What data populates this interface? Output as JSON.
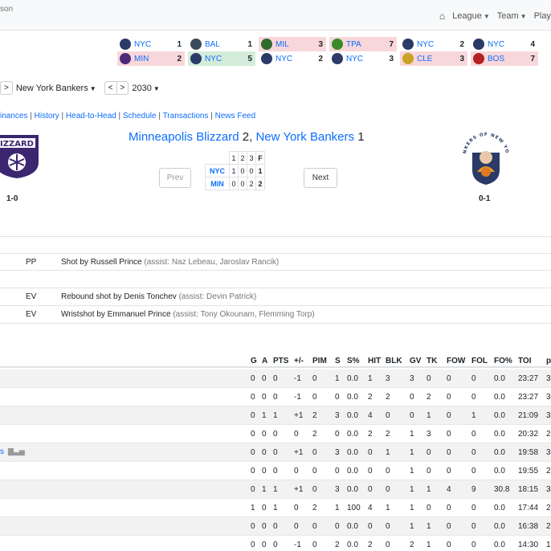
{
  "header": {
    "brand": "son",
    "nav": [
      {
        "label": "League"
      },
      {
        "label": "Team"
      },
      {
        "label": "Play"
      }
    ]
  },
  "scoreboard": [
    {
      "top": {
        "abbr": "NYC",
        "pts": "1",
        "result": "",
        "logo_color": "#2b3a67"
      },
      "bottom": {
        "abbr": "MIN",
        "pts": "2",
        "result": "loss",
        "logo_color": "#4b2a7b"
      }
    },
    {
      "top": {
        "abbr": "BAL",
        "pts": "1",
        "result": "",
        "logo_color": "#3a4a5a"
      },
      "bottom": {
        "abbr": "NYC",
        "pts": "5",
        "result": "win",
        "logo_color": "#2b3a67"
      }
    },
    {
      "top": {
        "abbr": "MIL",
        "pts": "3",
        "result": "loss",
        "logo_color": "#2f6b2f"
      },
      "bottom": {
        "abbr": "NYC",
        "pts": "2",
        "result": "",
        "logo_color": "#2b3a67"
      }
    },
    {
      "top": {
        "abbr": "TPA",
        "pts": "7",
        "result": "loss",
        "logo_color": "#3a8a2a"
      },
      "bottom": {
        "abbr": "NYC",
        "pts": "3",
        "result": "",
        "logo_color": "#2b3a67"
      }
    },
    {
      "top": {
        "abbr": "NYC",
        "pts": "2",
        "result": "",
        "logo_color": "#2b3a67"
      },
      "bottom": {
        "abbr": "CLE",
        "pts": "3",
        "result": "loss",
        "logo_color": "#c9a227"
      }
    },
    {
      "top": {
        "abbr": "NYC",
        "pts": "4",
        "result": "",
        "logo_color": "#2b3a67"
      },
      "bottom": {
        "abbr": "BOS",
        "pts": "7",
        "result": "loss",
        "logo_color": "#b22222"
      }
    }
  ],
  "selector": {
    "prev": "<",
    "next": ">",
    "team": "New York Bankers",
    "season": "2030"
  },
  "links": [
    "inances",
    "History",
    "Head-to-Head",
    "Schedule",
    "Transactions",
    "News Feed"
  ],
  "game": {
    "away_name": "Minneapolis Blizzard",
    "away_score": "2",
    "home_name": "New York Bankers",
    "home_score": "1",
    "away_logo_text": "IZZARD",
    "home_logo_text": "BANKERS OF NEW YORK",
    "away_record": "1-0",
    "home_record": "0-1",
    "prev_label": "Prev",
    "next_label": "Next",
    "linescore": {
      "header": [
        "",
        "1",
        "2",
        "3",
        "F"
      ],
      "rows": [
        [
          "NYC",
          "1",
          "0",
          "0",
          "1"
        ],
        [
          "MIN",
          "0",
          "0",
          "2",
          "2"
        ]
      ]
    }
  },
  "plays": [
    {
      "type": "PP",
      "desc": "Shot by Russell Prince",
      "assist": "(assist: Naz Lebeau, Jaroslav Rancik)"
    },
    {
      "type": "EV",
      "desc": "Rebound shot by Denis Tonchev",
      "assist": "(assist: Devin Patrick)"
    },
    {
      "type": "EV",
      "desc": "Wristshot by Emmanuel Prince",
      "assist": "(assist: Tony Okounam, Flemming Torp)"
    }
  ],
  "boxscore": {
    "columns": [
      "G",
      "A",
      "PTS",
      "+/-",
      "PIM",
      "S",
      "S%",
      "HIT",
      "BLK",
      "GV",
      "TK",
      "FOW",
      "FOL",
      "FO%",
      "TOI",
      "p"
    ],
    "rows": [
      {
        "name": "",
        "values": [
          "0",
          "0",
          "0",
          "-1",
          "0",
          "1",
          "0.0",
          "1",
          "3",
          "3",
          "0",
          "0",
          "0",
          "0.0",
          "23:27",
          "3"
        ]
      },
      {
        "name": "",
        "values": [
          "0",
          "0",
          "0",
          "-1",
          "0",
          "0",
          "0.0",
          "2",
          "2",
          "0",
          "2",
          "0",
          "0",
          "0.0",
          "23:27",
          "3"
        ]
      },
      {
        "name": "",
        "values": [
          "0",
          "1",
          "1",
          "+1",
          "2",
          "3",
          "0.0",
          "4",
          "0",
          "0",
          "1",
          "0",
          "1",
          "0.0",
          "21:09",
          "3"
        ]
      },
      {
        "name": "",
        "values": [
          "0",
          "0",
          "0",
          "0",
          "2",
          "0",
          "0.0",
          "2",
          "2",
          "1",
          "3",
          "0",
          "0",
          "0.0",
          "20:32",
          "2"
        ]
      },
      {
        "name": "s",
        "values": [
          "0",
          "0",
          "0",
          "+1",
          "0",
          "3",
          "0.0",
          "0",
          "1",
          "1",
          "0",
          "0",
          "0",
          "0.0",
          "19:58",
          "3"
        ]
      },
      {
        "name": "",
        "values": [
          "0",
          "0",
          "0",
          "0",
          "0",
          "0",
          "0.0",
          "0",
          "0",
          "1",
          "0",
          "0",
          "0",
          "0.0",
          "19:55",
          "2"
        ]
      },
      {
        "name": "",
        "values": [
          "0",
          "1",
          "1",
          "+1",
          "0",
          "3",
          "0.0",
          "0",
          "0",
          "1",
          "1",
          "4",
          "9",
          "30.8",
          "18:15",
          "3"
        ]
      },
      {
        "name": "",
        "values": [
          "1",
          "0",
          "1",
          "0",
          "2",
          "1",
          "100",
          "4",
          "1",
          "1",
          "0",
          "0",
          "0",
          "0.0",
          "17:44",
          "2"
        ]
      },
      {
        "name": "",
        "values": [
          "0",
          "0",
          "0",
          "0",
          "0",
          "0",
          "0.0",
          "0",
          "0",
          "1",
          "1",
          "0",
          "0",
          "0.0",
          "16:38",
          "2"
        ]
      },
      {
        "name": "",
        "values": [
          "0",
          "0",
          "0",
          "-1",
          "0",
          "2",
          "0.0",
          "2",
          "0",
          "2",
          "1",
          "0",
          "0",
          "0.0",
          "14:30",
          "1"
        ]
      }
    ]
  }
}
